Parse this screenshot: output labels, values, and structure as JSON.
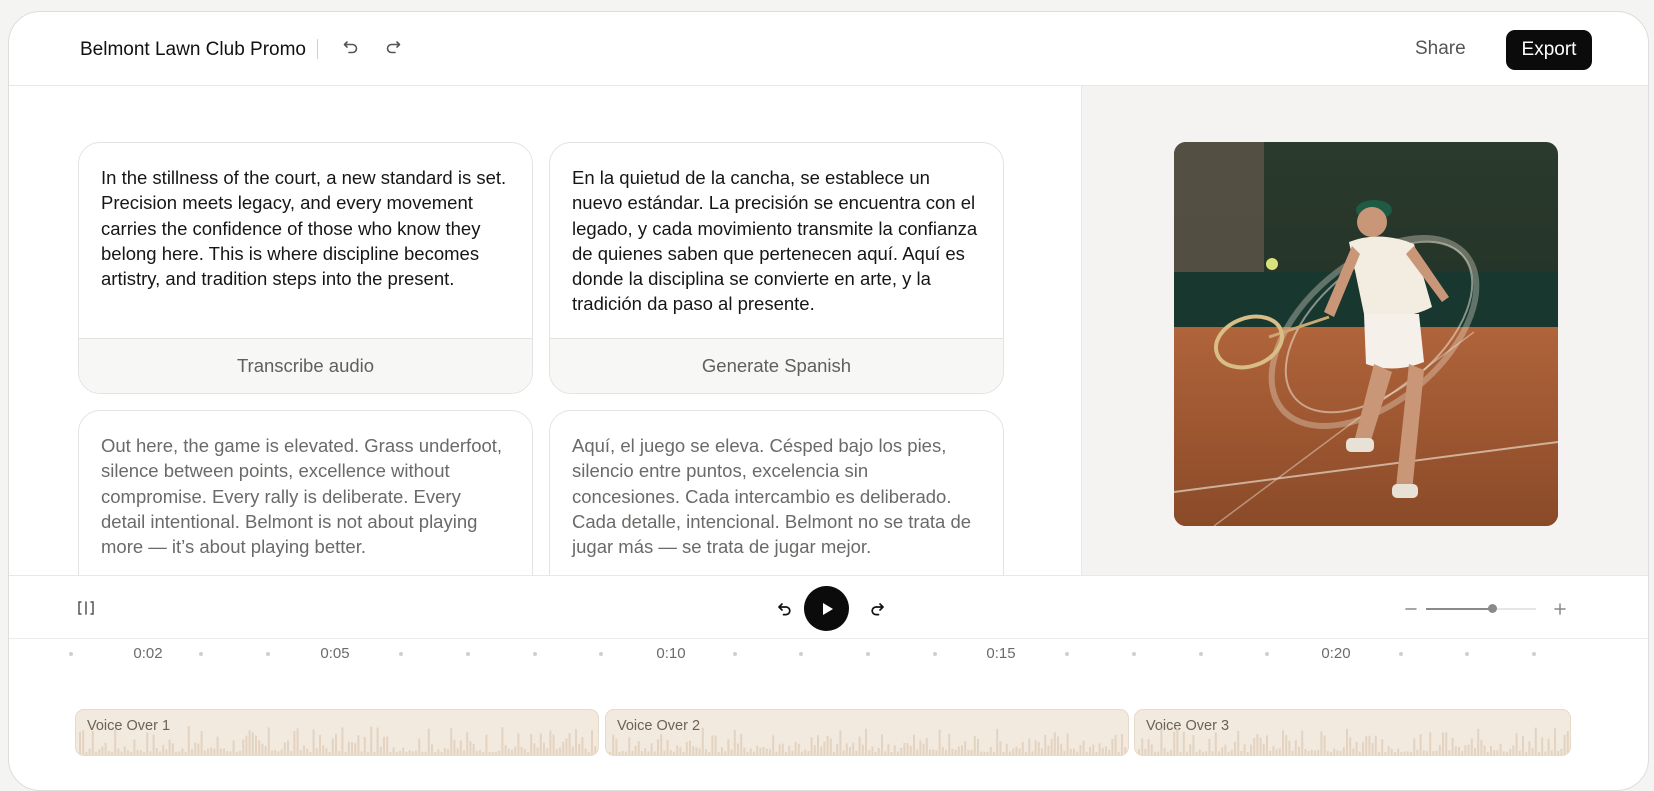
{
  "header": {
    "title": "Belmont Lawn Club Promo",
    "share_label": "Share",
    "export_label": "Export"
  },
  "cards": [
    {
      "text": "In the stillness of the court, a new standard is set. Precision meets legacy, and every movement carries the confidence of those who know they belong here. This is where discipline becomes artistry, and tradition steps into the present.",
      "action_label": "Transcribe audio"
    },
    {
      "text": "En la quietud de la cancha, se establece un nuevo estándar. La precisión se encuentra con el legado, y cada movimiento transmite la confianza de quienes saben que pertenecen aquí. Aquí es donde la disciplina se convierte en arte, y la tradición da paso al presente.",
      "action_label": "Generate Spanish"
    },
    {
      "text": "Out here, the game is elevated. Grass underfoot, silence between points, excellence without compromise. Every rally is deliberate. Every detail intentional. Belmont is not about playing more — it’s about playing better."
    },
    {
      "text": "Aquí, el juego se eleva. Césped bajo los pies, silencio entre puntos, excelencia sin concesiones. Cada intercambio es deliberado. Cada detalle, intencional. Belmont no se trata de jugar más — se trata de jugar mejor."
    }
  ],
  "preview": {
    "image_description": "tennis-player-photo"
  },
  "transport": {
    "zoom_level": 0.6
  },
  "timeline": {
    "labels": [
      "0:02",
      "0:05",
      "0:10",
      "0:15",
      "0:20"
    ],
    "clips": [
      {
        "label": "Voice Over 1"
      },
      {
        "label": "Voice Over 2"
      },
      {
        "label": "Voice Over 3"
      }
    ]
  },
  "colors": {
    "accent": "#0b0b0b",
    "clip_fill": "#f2e9df",
    "panel_bg": "#f4f3f1"
  },
  "icons": [
    "undo-icon",
    "redo-icon",
    "panel-toggle-icon",
    "rewind-icon",
    "play-icon",
    "forward-icon",
    "zoom-out-icon",
    "zoom-in-icon"
  ]
}
